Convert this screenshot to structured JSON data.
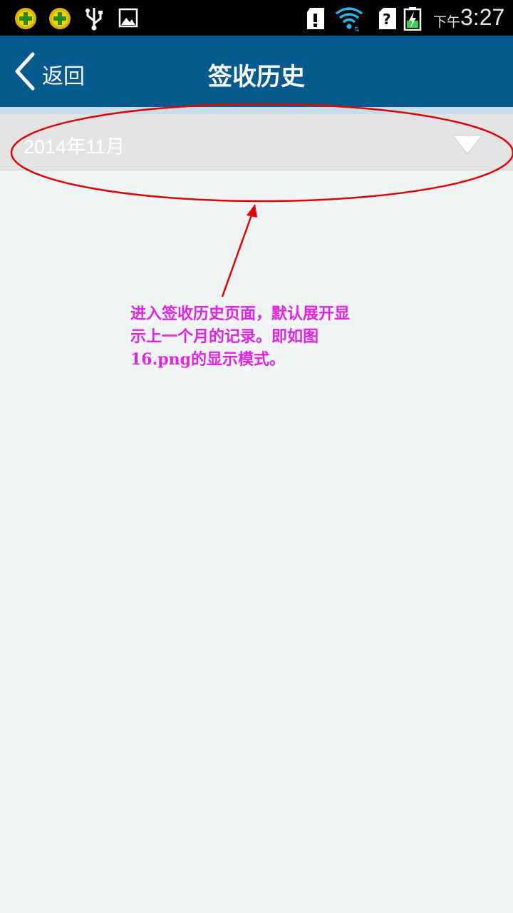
{
  "status_bar": {
    "icons": [
      "360-security-icon",
      "360-security-icon",
      "usb-icon",
      "image-icon",
      "sd-card-icon",
      "wifi-icon",
      "sim-icon",
      "battery-charging-icon"
    ],
    "time_prefix": "下午",
    "time": "3:27"
  },
  "header": {
    "back_label": "返回",
    "title": "签收历史",
    "color": "#045a8d"
  },
  "month_list": {
    "selected_month": "2014年11月",
    "expanded_indicator": "triangle-down-icon"
  },
  "annotation": {
    "color": "#e223e6",
    "circle_color": "#e00000",
    "lines": [
      "进入签收历史页面，默认展开显",
      "示上一个月的记录。即如图",
      "16.png的显示模式。"
    ]
  }
}
